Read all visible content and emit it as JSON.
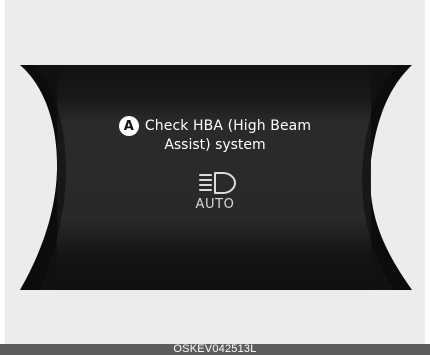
{
  "display": {
    "marker": "A",
    "message_line_1": "Check HBA (High Beam",
    "message_line_2": "Assist) system",
    "icon": "high-beam-assist-icon",
    "status_label": "AUTO"
  },
  "caption": {
    "code": "OSKEV042513L"
  },
  "colors": {
    "background": "#ececec",
    "display_black": "#111111",
    "display_center": "#262626",
    "text": "#ffffff",
    "caption_bar": "#5d5d5d"
  }
}
